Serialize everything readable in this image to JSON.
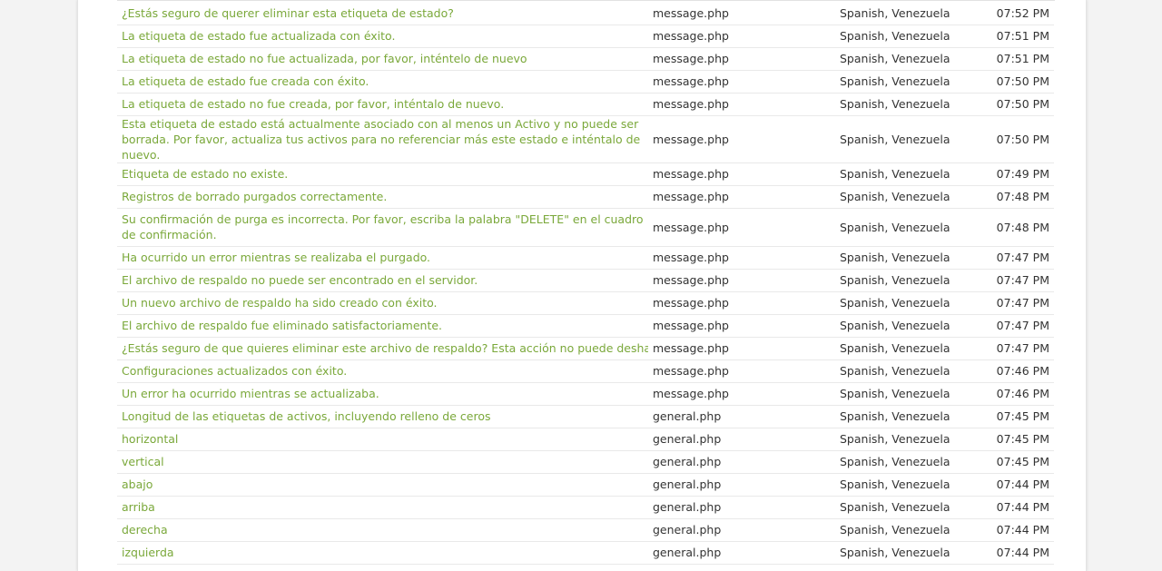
{
  "rows": [
    {
      "text": "¿Estás seguro de querer eliminar esta etiqueta de estado?",
      "file": "message.php",
      "locale": "Spanish, Venezuela",
      "time": "07:52 PM"
    },
    {
      "text": "La etiqueta de estado fue actualizada con éxito.",
      "file": "message.php",
      "locale": "Spanish, Venezuela",
      "time": "07:51 PM"
    },
    {
      "text": "La etiqueta de estado no fue actualizada, por favor, inténtelo de nuevo",
      "file": "message.php",
      "locale": "Spanish, Venezuela",
      "time": "07:51 PM"
    },
    {
      "text": "La etiqueta de estado fue creada con éxito.",
      "file": "message.php",
      "locale": "Spanish, Venezuela",
      "time": "07:50 PM"
    },
    {
      "text": "La etiqueta de estado no fue creada, por favor, inténtalo de nuevo.",
      "file": "message.php",
      "locale": "Spanish, Venezuela",
      "time": "07:50 PM"
    },
    {
      "text": "Esta etiqueta de estado está actualmente asociado con al menos un Activo y no puede ser borrada. Por favor, actualiza tus activos para no referenciar más este estado e inténtalo de nuevo.",
      "file": "message.php",
      "locale": "Spanish, Venezuela",
      "time": "07:50 PM"
    },
    {
      "text": "Etiqueta de estado no existe.",
      "file": "message.php",
      "locale": "Spanish, Venezuela",
      "time": "07:49 PM"
    },
    {
      "text": "Registros de borrado purgados correctamente.",
      "file": "message.php",
      "locale": "Spanish, Venezuela",
      "time": "07:48 PM"
    },
    {
      "text": "Su confirmación de purga es incorrecta. Por favor, escriba la palabra \"DELETE\" en el cuadro de confirmación.",
      "file": "message.php",
      "locale": "Spanish, Venezuela",
      "time": "07:48 PM"
    },
    {
      "text": "Ha ocurrido un error mientras se realizaba el purgado.",
      "file": "message.php",
      "locale": "Spanish, Venezuela",
      "time": "07:47 PM"
    },
    {
      "text": "El archivo de respaldo no puede ser encontrado en el servidor.",
      "file": "message.php",
      "locale": "Spanish, Venezuela",
      "time": "07:47 PM"
    },
    {
      "text": "Un nuevo archivo de respaldo ha sido creado con éxito.",
      "file": "message.php",
      "locale": "Spanish, Venezuela",
      "time": "07:47 PM"
    },
    {
      "text": "El archivo de respaldo fue eliminado satisfactoriamente.",
      "file": "message.php",
      "locale": "Spanish, Venezuela",
      "time": "07:47 PM"
    },
    {
      "text": "¿Estás seguro de que quieres eliminar este archivo de respaldo? Esta acción no puede deshacerse.",
      "file": "message.php",
      "locale": "Spanish, Venezuela",
      "time": "07:47 PM"
    },
    {
      "text": "Configuraciones actualizados con éxito.",
      "file": "message.php",
      "locale": "Spanish, Venezuela",
      "time": "07:46 PM"
    },
    {
      "text": "Un error ha ocurrido mientras se actualizaba.",
      "file": "message.php",
      "locale": "Spanish, Venezuela",
      "time": "07:46 PM"
    },
    {
      "text": "Longitud de las etiquetas de activos, incluyendo relleno de ceros",
      "file": "general.php",
      "locale": "Spanish, Venezuela",
      "time": "07:45 PM"
    },
    {
      "text": "horizontal",
      "file": "general.php",
      "locale": "Spanish, Venezuela",
      "time": "07:45 PM"
    },
    {
      "text": "vertical",
      "file": "general.php",
      "locale": "Spanish, Venezuela",
      "time": "07:45 PM"
    },
    {
      "text": "abajo",
      "file": "general.php",
      "locale": "Spanish, Venezuela",
      "time": "07:44 PM"
    },
    {
      "text": "arriba",
      "file": "general.php",
      "locale": "Spanish, Venezuela",
      "time": "07:44 PM"
    },
    {
      "text": "derecha",
      "file": "general.php",
      "locale": "Spanish, Venezuela",
      "time": "07:44 PM"
    },
    {
      "text": "izquierda",
      "file": "general.php",
      "locale": "Spanish, Venezuela",
      "time": "07:44 PM"
    }
  ],
  "colors": {
    "link_green": "#7aa83a",
    "text_dark": "#333333",
    "page_bg": "#f3f3f3",
    "panel_bg": "#ffffff",
    "row_border": "#e9e9e9"
  }
}
